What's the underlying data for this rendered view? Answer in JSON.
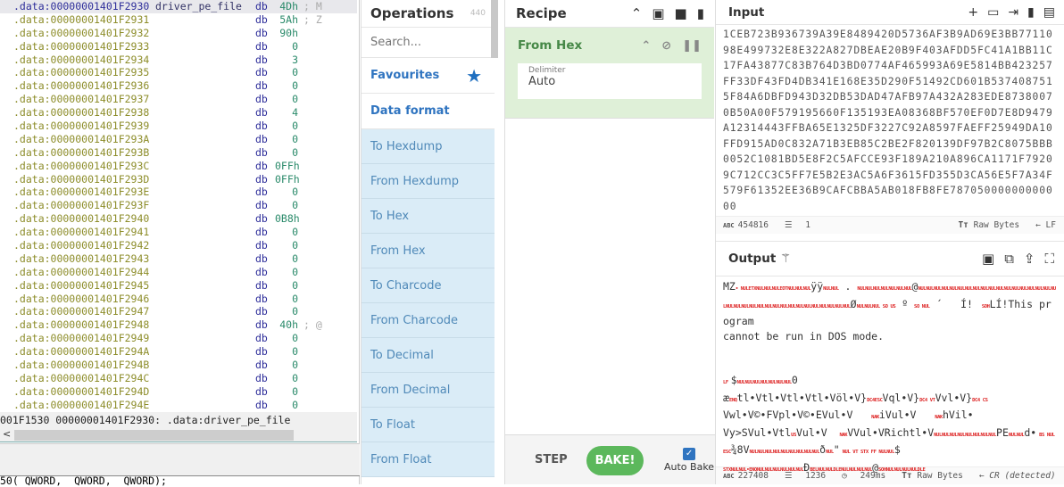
{
  "ida": {
    "rows": [
      {
        "addr": ".data:00000001401F2930",
        "label": "driver_pe_file",
        "op": "db",
        "val": "4Dh",
        "cmt": "; M"
      },
      {
        "addr": ".data:00000001401F2931",
        "label": "",
        "op": "db",
        "val": "5Ah",
        "cmt": "; Z"
      },
      {
        "addr": ".data:00000001401F2932",
        "label": "",
        "op": "db",
        "val": "90h",
        "cmt": ""
      },
      {
        "addr": ".data:00000001401F2933",
        "label": "",
        "op": "db",
        "val": "0",
        "cmt": ""
      },
      {
        "addr": ".data:00000001401F2934",
        "label": "",
        "op": "db",
        "val": "3",
        "cmt": ""
      },
      {
        "addr": ".data:00000001401F2935",
        "label": "",
        "op": "db",
        "val": "0",
        "cmt": ""
      },
      {
        "addr": ".data:00000001401F2936",
        "label": "",
        "op": "db",
        "val": "0",
        "cmt": ""
      },
      {
        "addr": ".data:00000001401F2937",
        "label": "",
        "op": "db",
        "val": "0",
        "cmt": ""
      },
      {
        "addr": ".data:00000001401F2938",
        "label": "",
        "op": "db",
        "val": "4",
        "cmt": ""
      },
      {
        "addr": ".data:00000001401F2939",
        "label": "",
        "op": "db",
        "val": "0",
        "cmt": ""
      },
      {
        "addr": ".data:00000001401F293A",
        "label": "",
        "op": "db",
        "val": "0",
        "cmt": ""
      },
      {
        "addr": ".data:00000001401F293B",
        "label": "",
        "op": "db",
        "val": "0",
        "cmt": ""
      },
      {
        "addr": ".data:00000001401F293C",
        "label": "",
        "op": "db",
        "val": "0FFh",
        "cmt": ""
      },
      {
        "addr": ".data:00000001401F293D",
        "label": "",
        "op": "db",
        "val": "0FFh",
        "cmt": ""
      },
      {
        "addr": ".data:00000001401F293E",
        "label": "",
        "op": "db",
        "val": "0",
        "cmt": ""
      },
      {
        "addr": ".data:00000001401F293F",
        "label": "",
        "op": "db",
        "val": "0",
        "cmt": ""
      },
      {
        "addr": ".data:00000001401F2940",
        "label": "",
        "op": "db",
        "val": "0B8h",
        "cmt": ""
      },
      {
        "addr": ".data:00000001401F2941",
        "label": "",
        "op": "db",
        "val": "0",
        "cmt": ""
      },
      {
        "addr": ".data:00000001401F2942",
        "label": "",
        "op": "db",
        "val": "0",
        "cmt": ""
      },
      {
        "addr": ".data:00000001401F2943",
        "label": "",
        "op": "db",
        "val": "0",
        "cmt": ""
      },
      {
        "addr": ".data:00000001401F2944",
        "label": "",
        "op": "db",
        "val": "0",
        "cmt": ""
      },
      {
        "addr": ".data:00000001401F2945",
        "label": "",
        "op": "db",
        "val": "0",
        "cmt": ""
      },
      {
        "addr": ".data:00000001401F2946",
        "label": "",
        "op": "db",
        "val": "0",
        "cmt": ""
      },
      {
        "addr": ".data:00000001401F2947",
        "label": "",
        "op": "db",
        "val": "0",
        "cmt": ""
      },
      {
        "addr": ".data:00000001401F2948",
        "label": "",
        "op": "db",
        "val": "40h",
        "cmt": "; @"
      },
      {
        "addr": ".data:00000001401F2949",
        "label": "",
        "op": "db",
        "val": "0",
        "cmt": ""
      },
      {
        "addr": ".data:00000001401F294A",
        "label": "",
        "op": "db",
        "val": "0",
        "cmt": ""
      },
      {
        "addr": ".data:00000001401F294B",
        "label": "",
        "op": "db",
        "val": "0",
        "cmt": ""
      },
      {
        "addr": ".data:00000001401F294C",
        "label": "",
        "op": "db",
        "val": "0",
        "cmt": ""
      },
      {
        "addr": ".data:00000001401F294D",
        "label": "",
        "op": "db",
        "val": "0",
        "cmt": ""
      },
      {
        "addr": ".data:00000001401F294E",
        "label": "",
        "op": "db",
        "val": "0",
        "cmt": ""
      }
    ],
    "status": "001F1530 00000001401F2930: .data:driver_pe_file",
    "bottom_text": "50( QWORD,  QWORD,  QWORD);"
  },
  "operations": {
    "title": "Operations",
    "count": "440",
    "search_placeholder": "Search...",
    "favourites": "Favourites",
    "category": "Data format",
    "items": [
      "To Hexdump",
      "From Hexdump",
      "To Hex",
      "From Hex",
      "To Charcode",
      "From Charcode",
      "To Decimal",
      "From Decimal",
      "To Float",
      "From Float"
    ]
  },
  "recipe": {
    "title": "Recipe",
    "operation": {
      "name": "From Hex",
      "delimiter_label": "Delimiter",
      "delimiter_value": "Auto"
    },
    "step": "STEP",
    "bake": "BAKE!",
    "auto_bake": "Auto Bake",
    "auto_bake_checked": true
  },
  "input": {
    "title": "Input",
    "text": "1CEB723B936739A39E8489420D5736AF3B9AD69E3BB7711098E499732E8E322A827DBEAE20B9F403AFDD5FC41A1BB11C17FA43877C83B764D3BD0774AF465993A69E5814BB423257FF33DF43FD4DB341E168E35D290F51492CD601B5374087515F84A6DBFD943D32DB53DAD47AFB97A432A283EDE87380070B50A00F579195660F135193EA08368BF570EF0D7E8D9479A12314443FFBA65E1325DF3227C92A8597FAEFF25949DA10FFD915AD0C832A71B3EB85C2BE2F820139DF97B2C8075BBB0052C1081BD5E8F2C5AFCCE93F189A210A896CA1171F79209C712CC3C5FF7E5B2E3AC5A6F3615FD355D3CA56E5F7A34F579F61352EE36B9CAFCBBA5AB018FB8FE78705000000000000",
    "length": "454816",
    "lines": "1",
    "encoding": "Raw Bytes",
    "eol": "LF"
  },
  "output": {
    "title": "Output",
    "segments": [
      [
        "MZ",
        0
      ],
      [
        "• NULETXNULNULNULEOTNULNULNUL",
        1
      ],
      [
        "ÿÿ",
        0
      ],
      [
        "NULNUL",
        1
      ],
      [
        " . ",
        0
      ],
      [
        "NULNULNULNULNULNULNUL",
        1
      ],
      [
        "@",
        0
      ],
      [
        "NULNULNULNULNUL",
        1
      ],
      [
        "NULNULNULNULNULNULNULNULNULNULNULNULNULNULNULNULNULNULNULNULNULNULNULNULNULNUL",
        1
      ],
      [
        "NULNULNUL",
        1
      ],
      [
        "Ø",
        0
      ],
      [
        "NULNULNUL SO US",
        1
      ],
      [
        " º ",
        0
      ],
      [
        "SO NUL",
        1
      ],
      [
        " ´   Í! ",
        0
      ],
      [
        " SOH",
        1
      ],
      [
        "LÍ!This program\ncannot be run in DOS mode.\n\n\n",
        0
      ],
      [
        "LF ",
        1
      ],
      [
        "$",
        0
      ],
      [
        "NULNULNULNULNULNULNUL",
        1
      ],
      [
        "0\næ",
        0
      ],
      [
        "ENQ",
        1
      ],
      [
        "tl•Vtl•Vtl•Vtl•Völ•V}",
        0
      ],
      [
        "DC4ESC",
        1
      ],
      [
        "Vql•V}",
        0
      ],
      [
        "DC4 VT",
        1
      ],
      [
        "Vvl•V}",
        0
      ],
      [
        "DC4 CS",
        1
      ],
      [
        "\nVwl•V©•FVpl•V©•EVul•V   ",
        0
      ],
      [
        "NAK",
        1
      ],
      [
        "iVul•V   ",
        0
      ],
      [
        "NAK",
        1
      ],
      [
        "hVil•\nVy>SVul•Vtl",
        0
      ],
      [
        "US",
        1
      ],
      [
        "Vul•V  ",
        0
      ],
      [
        "NAK",
        1
      ],
      [
        "VVul•VRichtl•V",
        0
      ],
      [
        "NULNULNULNULNULNULNUL",
        1
      ],
      [
        "NUL",
        1
      ],
      [
        "PE",
        0
      ],
      [
        "NULNUL",
        1
      ],
      [
        "d•",
        0
      ],
      [
        " BS NULESC",
        1
      ],
      [
        "¾8V",
        0
      ],
      [
        "NULNULNULNULNULNULNULNULNUL",
        1
      ],
      [
        "ð",
        0
      ],
      [
        "NUL",
        1
      ],
      [
        "\"",
        0
      ],
      [
        " NUL VT STX FF NULNUL",
        1
      ],
      [
        "$\n",
        0
      ],
      [
        "STXNULNUL•ENQNULNULNULNULNULNUL",
        1
      ],
      [
        "Ð",
        0
      ],
      [
        "BELNULNULDLENULNULNULNUL",
        1
      ],
      [
        "@",
        0
      ],
      [
        "SOHNULNULNULNULDLE",
        1
      ]
    ],
    "length": "227408",
    "lines": "1236",
    "time": "249ms",
    "encoding": "Raw Bytes",
    "eol": "CR (detected)"
  },
  "colors": {
    "accent": "#2f74c0",
    "recipe_bg": "#dff0d8",
    "recipe_text": "#468847",
    "bake": "#5cb85c",
    "ops_bg": "#daecf7",
    "control_char": "#dd2222"
  }
}
